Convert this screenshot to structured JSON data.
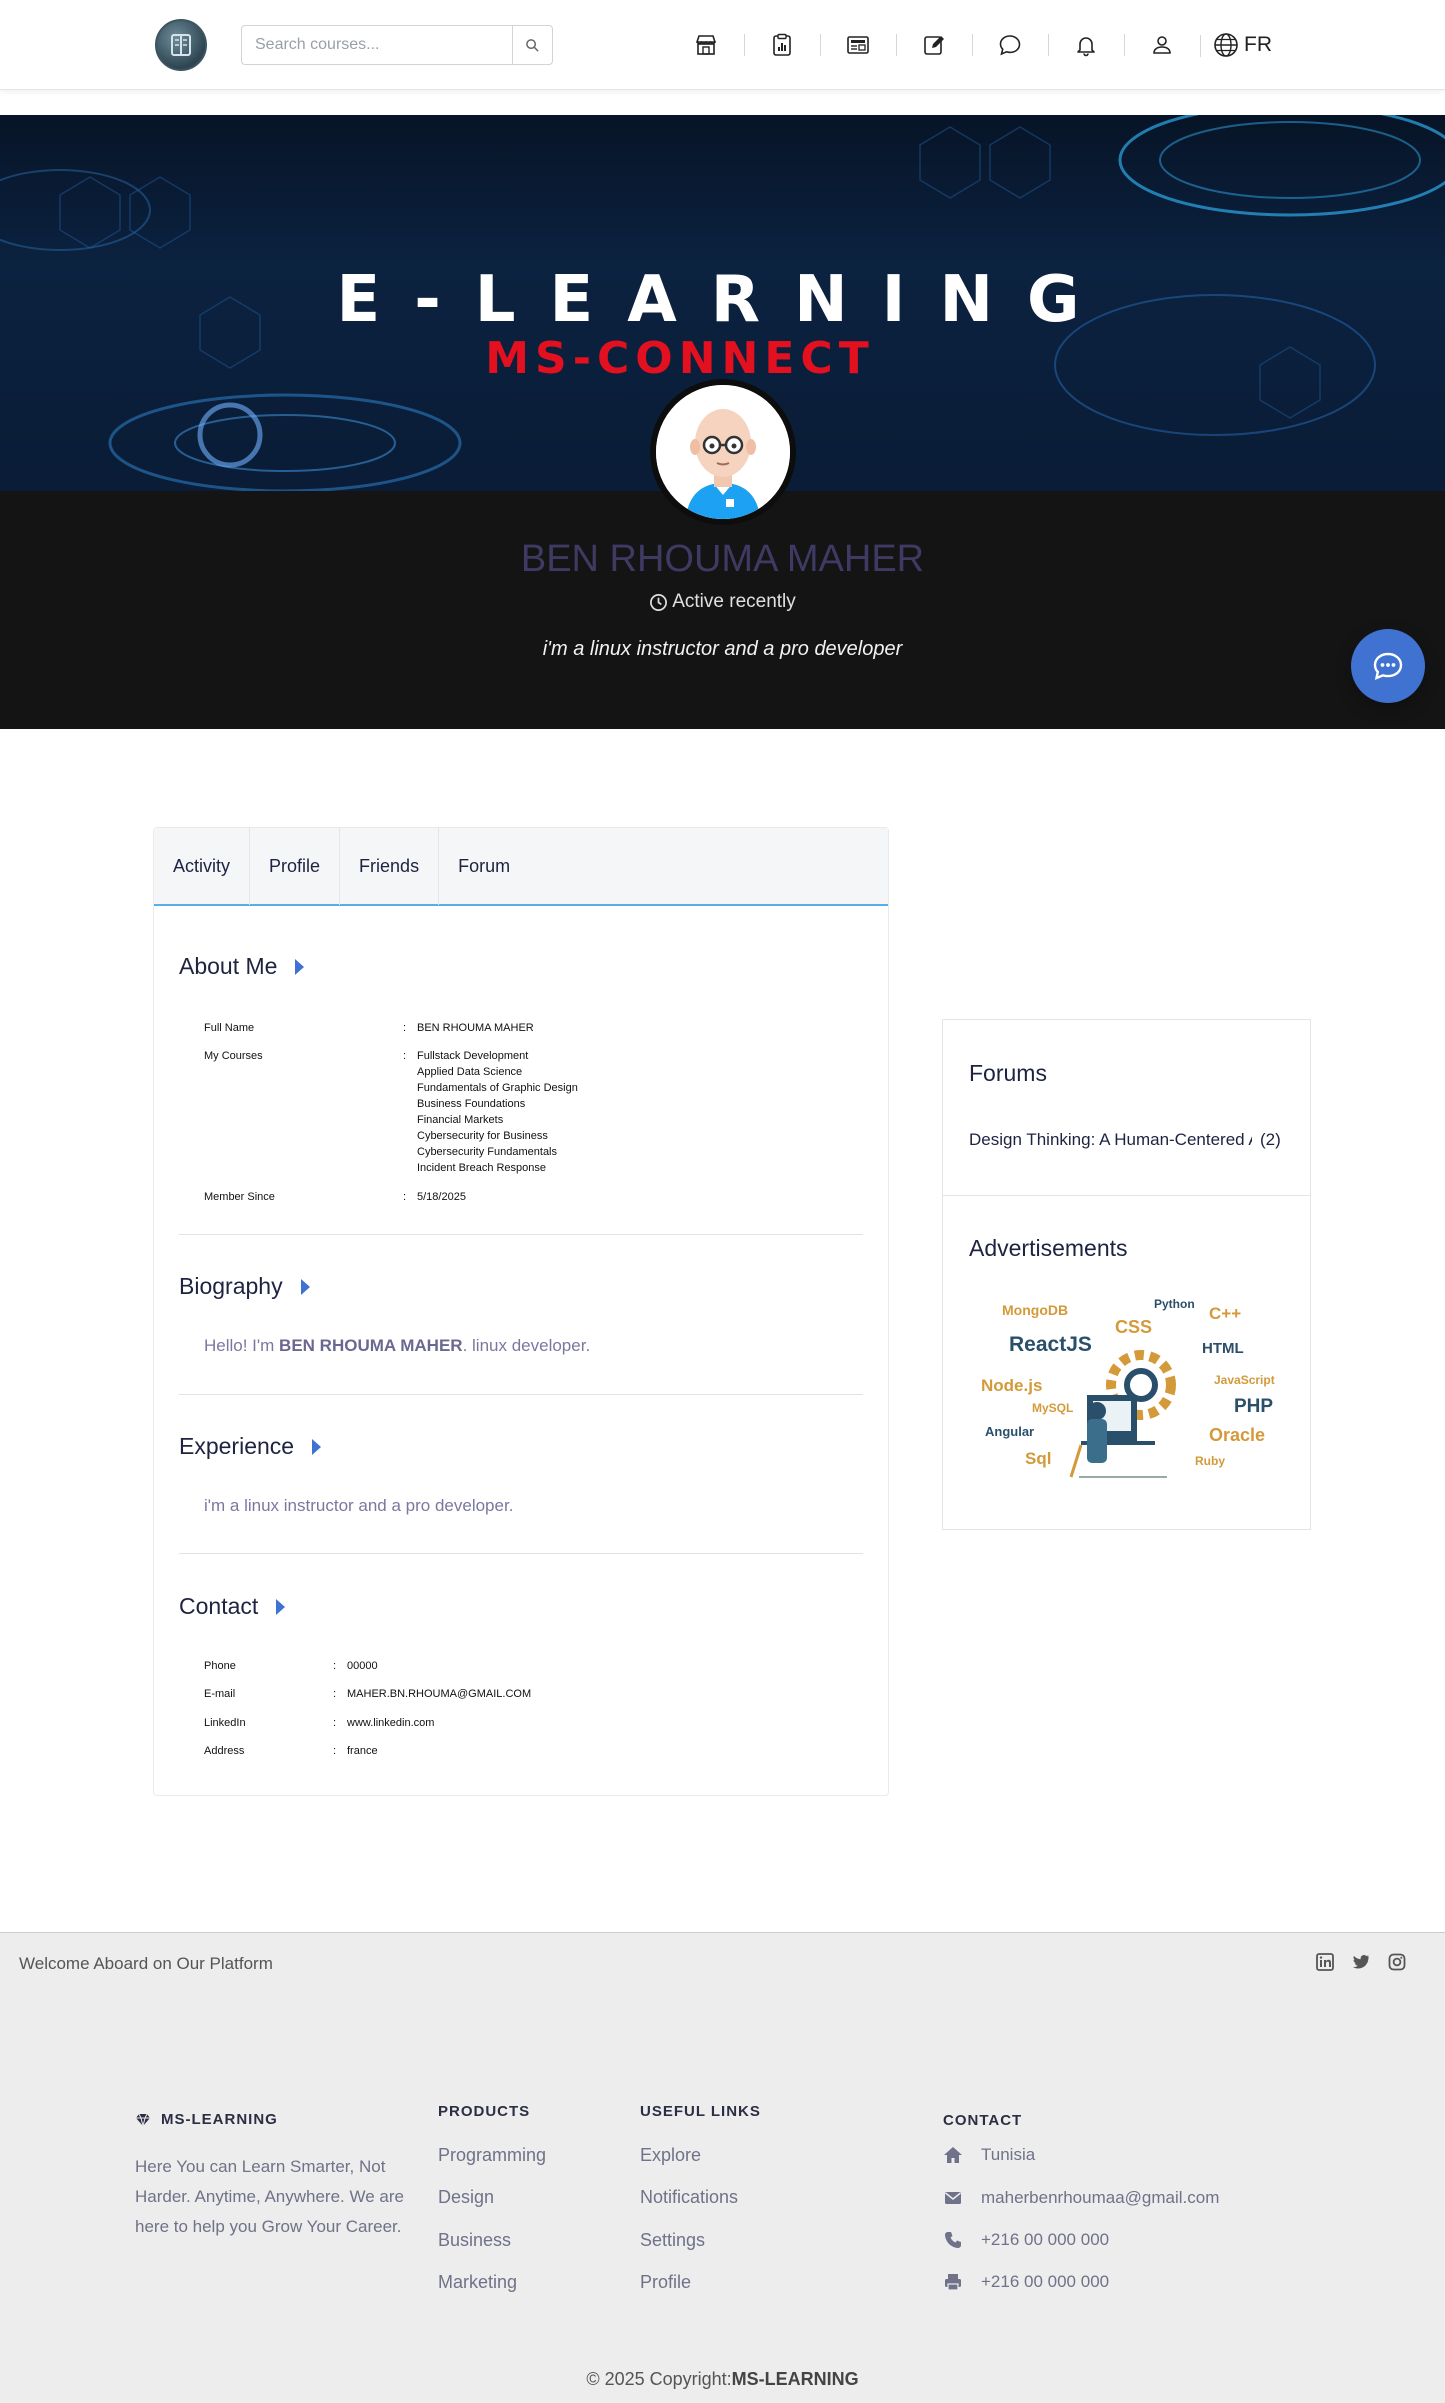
{
  "header": {
    "search_placeholder": "Search courses...",
    "nav_icons": [
      "store-icon",
      "clipboard-chart-icon",
      "newspaper-icon",
      "edit-icon",
      "chat-icon",
      "bell-icon",
      "user-icon"
    ],
    "lang": "FR"
  },
  "banner": {
    "title": "E-LEARNING",
    "subtitle": "MS-CONNECT"
  },
  "profile": {
    "name": "BEN RHOUMA MAHER",
    "status": "Active recently",
    "tagline": "i'm a linux instructor and a pro developer"
  },
  "tabs": [
    "Activity",
    "Profile",
    "Friends",
    "Forum"
  ],
  "about": {
    "title": "About Me",
    "full_name_label": "Full Name",
    "full_name": "BEN RHOUMA MAHER",
    "courses_label": "My Courses",
    "courses": [
      "Fullstack Development",
      "Applied Data Science",
      "Fundamentals of Graphic Design",
      "Business Foundations",
      "Financial Markets",
      "Cybersecurity for Business",
      "Cybersecurity Fundamentals",
      "Incident Breach Response"
    ],
    "member_since_label": "Member Since",
    "member_since": "5/18/2025",
    "colon": ":"
  },
  "biography": {
    "title": "Biography",
    "prefix": "Hello! I'm ",
    "name": "BEN RHOUMA MAHER",
    "suffix": ". linux developer."
  },
  "experience": {
    "title": "Experience",
    "text": "i'm a linux instructor and a pro developer."
  },
  "contact": {
    "title": "Contact",
    "phone_label": "Phone",
    "phone": "00000",
    "email_label": "E-mail",
    "email": "MAHER.BN.RHOUMA@GMAIL.COM",
    "linkedin_label": "LinkedIn",
    "linkedin": "www.linkedin.com",
    "address_label": "Address",
    "address": "france"
  },
  "sidebar": {
    "forums_title": "Forums",
    "forum_item": "Design Thinking: A Human-Centered Approach",
    "forum_count": "(2)",
    "ads_title": "Advertisements",
    "ad_words": [
      "MongoDB",
      "Python",
      "C++",
      "CSS",
      "ReactJS",
      "HTML",
      "Node.js",
      "JavaScript",
      "MySQL",
      "PHP",
      "Angular",
      "Oracle",
      "Sql",
      "Ruby"
    ]
  },
  "footer": {
    "welcome": "Welcome Aboard on Our Platform",
    "brand": "MS-LEARNING",
    "brand_desc": "Here You can Learn Smarter, Not Harder. Anytime, Anywhere. We are here to help you Grow Your Career.",
    "products_head": "PRODUCTS",
    "products": [
      "Programming",
      "Design",
      "Business",
      "Marketing"
    ],
    "links_head": "USEFUL LINKS",
    "links": [
      "Explore",
      "Notifications",
      "Settings",
      "Profile"
    ],
    "contact_head": "CONTACT",
    "address": "Tunisia",
    "email": "maherbenrhoumaa@gmail.com",
    "phone": "+216 00 000 000",
    "fax": "+216 00 000 000",
    "copyright_prefix": "© 2025 Copyright:",
    "copyright_brand": "MS-LEARNING"
  },
  "colors": {
    "accent": "#3f72d1",
    "tab_underline": "#5aaee8",
    "banner_red": "#e3101f",
    "dark_band": "#141414"
  }
}
